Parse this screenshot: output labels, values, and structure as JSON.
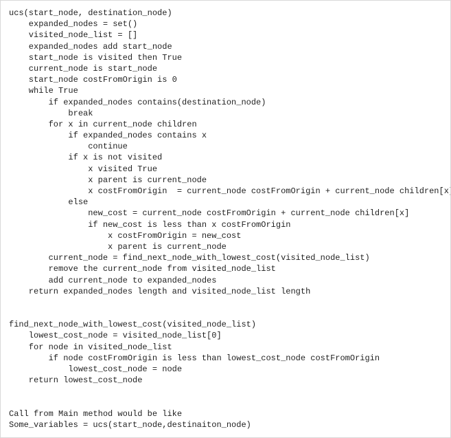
{
  "code": {
    "indent_unit": "    ",
    "lines": [
      {
        "indent": 0,
        "text": "ucs(start_node, destination_node)"
      },
      {
        "indent": 1,
        "text": "expanded_nodes = set()"
      },
      {
        "indent": 1,
        "text": "visited_node_list = []"
      },
      {
        "indent": 1,
        "text": "expanded_nodes add start_node"
      },
      {
        "indent": 1,
        "text": "start_node is visited then True"
      },
      {
        "indent": 1,
        "text": "current_node is start_node"
      },
      {
        "indent": 1,
        "text": "start_node costFromOrigin is 0"
      },
      {
        "indent": 1,
        "text": "while True"
      },
      {
        "indent": 2,
        "text": "if expanded_nodes contains(destination_node)"
      },
      {
        "indent": 3,
        "text": "break"
      },
      {
        "indent": 2,
        "text": "for x in current_node children"
      },
      {
        "indent": 3,
        "text": "if expanded_nodes contains x"
      },
      {
        "indent": 4,
        "text": "continue"
      },
      {
        "indent": 3,
        "text": "if x is not visited"
      },
      {
        "indent": 4,
        "text": "x visited True"
      },
      {
        "indent": 4,
        "text": "x parent is current_node"
      },
      {
        "indent": 4,
        "text": "x costFromOrigin  = current_node costFromOrigin + current_node children[x]"
      },
      {
        "indent": 3,
        "text": "else"
      },
      {
        "indent": 4,
        "text": "new_cost = current_node costFromOrigin + current_node children[x]"
      },
      {
        "indent": 4,
        "text": "if new_cost is less than x costFromOrigin"
      },
      {
        "indent": 5,
        "text": "x costFromOrigin = new_cost"
      },
      {
        "indent": 5,
        "text": "x parent is current_node"
      },
      {
        "indent": 2,
        "text": "current_node = find_next_node_with_lowest_cost(visited_node_list)"
      },
      {
        "indent": 2,
        "text": "remove the current_node from visited_node_list"
      },
      {
        "indent": 2,
        "text": "add current_node to expanded_nodes"
      },
      {
        "indent": 1,
        "text": "return expanded_nodes length and visited_node_list length"
      },
      {
        "indent": 0,
        "text": ""
      },
      {
        "indent": 0,
        "text": ""
      },
      {
        "indent": 0,
        "text": "find_next_node_with_lowest_cost(visited_node_list)"
      },
      {
        "indent": 1,
        "text": "lowest_cost_node = visited_node_list[0]"
      },
      {
        "indent": 1,
        "text": "for node in visited_node_list"
      },
      {
        "indent": 2,
        "text": "if node costFromOrigin is less than lowest_cost_node costFromOrigin"
      },
      {
        "indent": 3,
        "text": "lowest_cost_node = node"
      },
      {
        "indent": 1,
        "text": "return lowest_cost_node"
      },
      {
        "indent": 0,
        "text": ""
      },
      {
        "indent": 0,
        "text": ""
      },
      {
        "indent": 0,
        "text": "Call from Main method would be like"
      },
      {
        "indent": 0,
        "text": "Some_variables = ucs(start_node,destinaiton_node)"
      }
    ]
  }
}
